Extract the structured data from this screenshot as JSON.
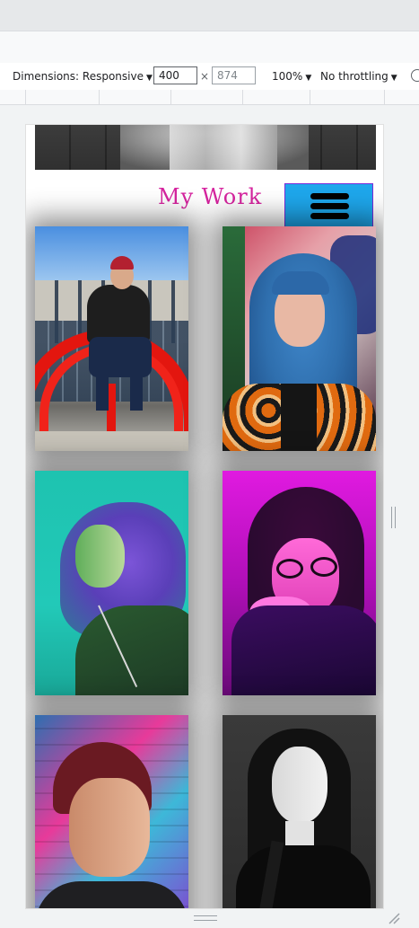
{
  "devtools": {
    "dimensions_label": "Dimensions: Responsive",
    "width_value": "400",
    "height_placeholder": "874",
    "times_symbol": "×",
    "zoom": "100%",
    "throttling": "No throttling",
    "caret": "▼"
  },
  "page": {
    "title": "My Work",
    "colors": {
      "title": "#d6249f",
      "menu_button": "#1ea7ec",
      "menu_border": "#7b2bd9"
    }
  },
  "gallery": {
    "photos": [
      {
        "name": "photo-man-on-red-sculpture"
      },
      {
        "name": "photo-blue-haired-woman-graffiti"
      },
      {
        "name": "photo-woman-green-blue-light"
      },
      {
        "name": "photo-woman-magenta-light-glasses"
      },
      {
        "name": "photo-man-beanie-graffiti"
      },
      {
        "name": "photo-woman-black-and-white"
      }
    ]
  }
}
